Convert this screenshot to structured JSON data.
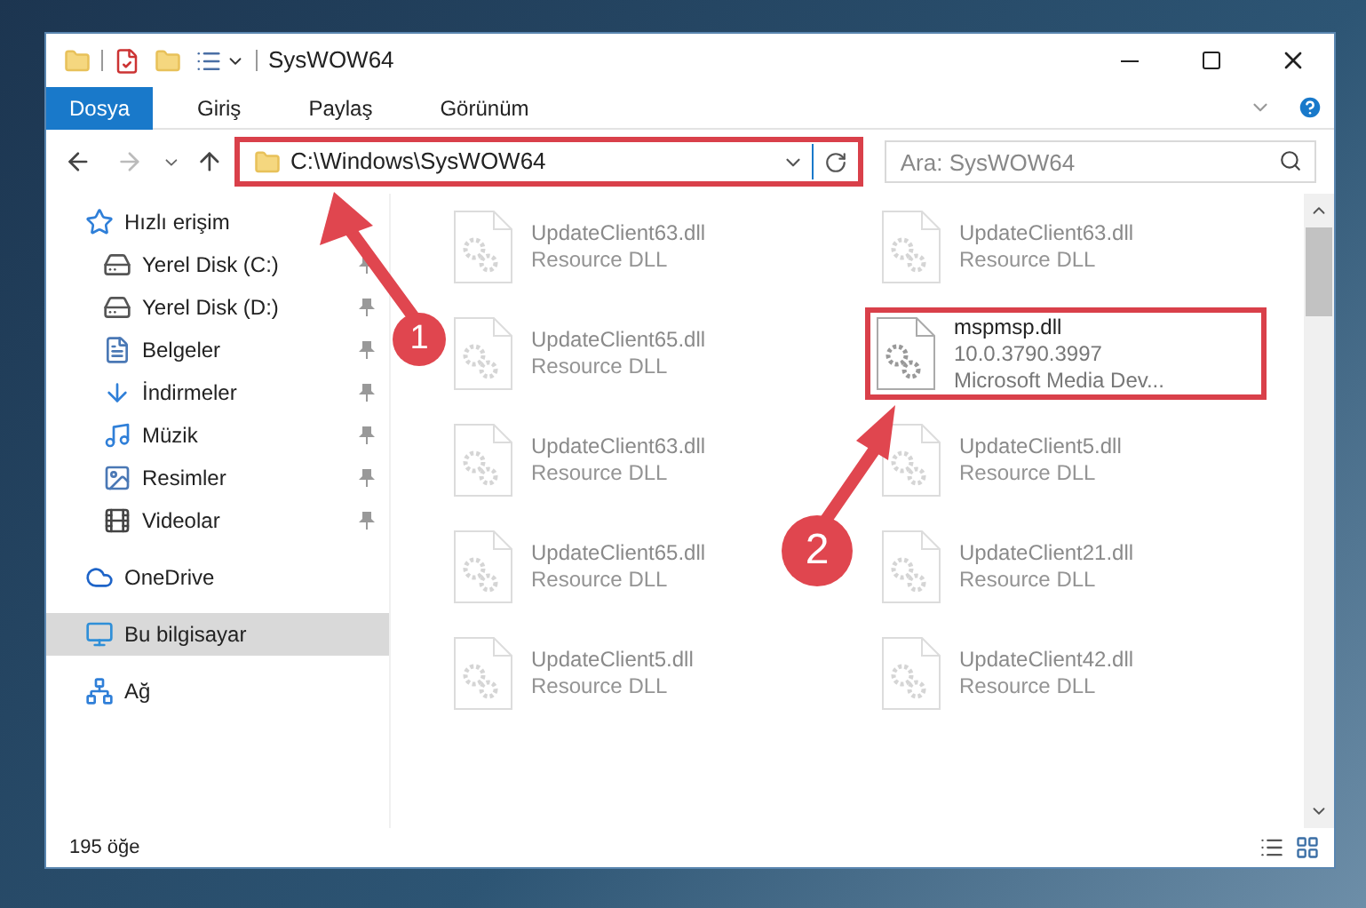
{
  "window": {
    "title": "SysWOW64"
  },
  "ribbon_tabs": [
    {
      "label": "Dosya",
      "selected": true
    },
    {
      "label": "Giriş",
      "selected": false
    },
    {
      "label": "Paylaş",
      "selected": false
    },
    {
      "label": "Görünüm",
      "selected": false
    }
  ],
  "address_bar": {
    "path": "C:\\Windows\\SysWOW64",
    "highlighted": true
  },
  "search": {
    "placeholder": "Ara: SysWOW64"
  },
  "sidebar": {
    "items": [
      {
        "label": "Hızlı erişim",
        "kind": "star",
        "selected": false,
        "children": [
          {
            "label": "Yerel Disk (C:)",
            "kind": "drive",
            "pinned": true,
            "selected": false
          },
          {
            "label": "Yerel Disk (D:)",
            "kind": "drive",
            "pinned": true,
            "selected": false
          },
          {
            "label": "Belgeler",
            "kind": "document",
            "pinned": true,
            "selected": false
          },
          {
            "label": "İndirmeler",
            "kind": "download",
            "pinned": true,
            "selected": false
          },
          {
            "label": "Müzik",
            "kind": "music",
            "pinned": true,
            "selected": false
          },
          {
            "label": "Resimler",
            "kind": "picture",
            "pinned": true,
            "selected": false
          },
          {
            "label": "Videolar",
            "kind": "video",
            "pinned": true,
            "selected": false
          }
        ]
      },
      {
        "label": "OneDrive",
        "kind": "cloud",
        "selected": false
      },
      {
        "label": "Bu bilgisayar",
        "kind": "computer",
        "selected": true
      },
      {
        "label": "Ağ",
        "kind": "network",
        "selected": false
      }
    ]
  },
  "files": [
    {
      "name": "UpdateClient63.dll",
      "details": [
        "Resource DLL"
      ],
      "dimmed": true,
      "highlighted": false
    },
    {
      "name": "UpdateClient63.dll",
      "details": [
        "Resource DLL"
      ],
      "dimmed": true,
      "highlighted": false
    },
    {
      "name": "UpdateClient65.dll",
      "details": [
        "Resource DLL"
      ],
      "dimmed": true,
      "highlighted": false
    },
    {
      "name": "mspmsp.dll",
      "details": [
        "10.0.3790.3997",
        "Microsoft Media Dev..."
      ],
      "dimmed": false,
      "highlighted": true
    },
    {
      "name": "UpdateClient63.dll",
      "details": [
        "Resource DLL"
      ],
      "dimmed": true,
      "highlighted": false
    },
    {
      "name": "UpdateClient5.dll",
      "details": [
        "Resource DLL"
      ],
      "dimmed": true,
      "highlighted": false
    },
    {
      "name": "UpdateClient65.dll",
      "details": [
        "Resource DLL"
      ],
      "dimmed": true,
      "highlighted": false
    },
    {
      "name": "UpdateClient21.dll",
      "details": [
        "Resource DLL"
      ],
      "dimmed": true,
      "highlighted": false
    },
    {
      "name": "UpdateClient5.dll",
      "details": [
        "Resource DLL"
      ],
      "dimmed": true,
      "highlighted": false
    },
    {
      "name": "UpdateClient42.dll",
      "details": [
        "Resource DLL"
      ],
      "dimmed": true,
      "highlighted": false
    }
  ],
  "status_bar": {
    "item_count": "195 öğe"
  },
  "annotations": [
    {
      "label": "1"
    },
    {
      "label": "2"
    }
  ]
}
